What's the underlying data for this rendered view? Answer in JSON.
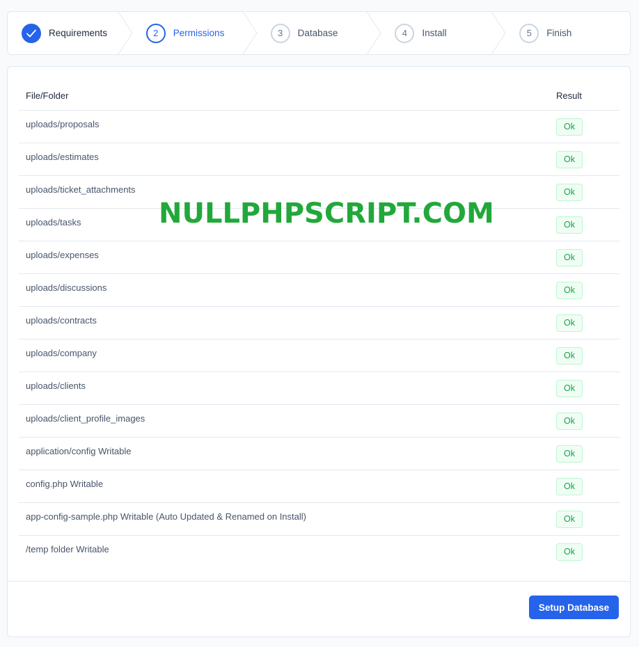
{
  "steps": [
    {
      "number": "",
      "label": "Requirements",
      "state": "done"
    },
    {
      "number": "2",
      "label": "Permissions",
      "state": "active"
    },
    {
      "number": "3",
      "label": "Database",
      "state": "pending"
    },
    {
      "number": "4",
      "label": "Install",
      "state": "pending"
    },
    {
      "number": "5",
      "label": "Finish",
      "state": "pending"
    }
  ],
  "table": {
    "header_file": "File/Folder",
    "header_result": "Result",
    "rows": [
      {
        "file": "uploads/proposals",
        "result": "Ok"
      },
      {
        "file": "uploads/estimates",
        "result": "Ok"
      },
      {
        "file": "uploads/ticket_attachments",
        "result": "Ok"
      },
      {
        "file": "uploads/tasks",
        "result": "Ok"
      },
      {
        "file": "uploads/expenses",
        "result": "Ok"
      },
      {
        "file": "uploads/discussions",
        "result": "Ok"
      },
      {
        "file": "uploads/contracts",
        "result": "Ok"
      },
      {
        "file": "uploads/company",
        "result": "Ok"
      },
      {
        "file": "uploads/clients",
        "result": "Ok"
      },
      {
        "file": "uploads/client_profile_images",
        "result": "Ok"
      },
      {
        "file": "application/config Writable",
        "result": "Ok"
      },
      {
        "file": "config.php Writable",
        "result": "Ok"
      },
      {
        "file": "app-config-sample.php Writable (Auto Updated & Renamed on Install)",
        "result": "Ok"
      },
      {
        "file": "/temp folder Writable",
        "result": "Ok"
      }
    ]
  },
  "footer": {
    "button_label": "Setup Database"
  },
  "watermark": "NULLPHPSCRIPT.COM",
  "colors": {
    "accent": "#2563eb",
    "success": "#16a34a",
    "watermark": "#22a83a"
  }
}
